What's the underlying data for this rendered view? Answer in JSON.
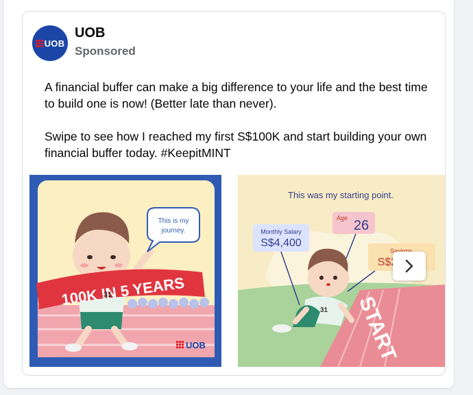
{
  "post": {
    "page_name": "UOB",
    "sponsored_label": "Sponsored",
    "avatar_text": "UOB",
    "paragraphs": [
      "A financial buffer can make a big difference to your life and the best time to build one is now! (Better late than never).",
      "Swipe to see how I reached my first S$100K and start building your own financial buffer today. #KeepitMINT"
    ]
  },
  "carousel": {
    "slides": [
      {
        "bubble_line1": "This is my",
        "bubble_line2": "journey.",
        "banner_text": "100K IN 5 YEARS",
        "bib_number": "31",
        "logo_text": "UOB"
      },
      {
        "heading": "This was my starting point.",
        "salary_label": "Monthly Salary",
        "salary_value": "S$4,400",
        "age_label": "Age",
        "age_value": "26",
        "savings_label": "Savings",
        "savings_value": "S$20,000",
        "start_text": "START",
        "bib_number": "31"
      }
    ],
    "next_icon": "chevron-right-icon"
  },
  "colors": {
    "brand_blue": "#1b46a8",
    "brand_red": "#e31b23",
    "text_primary": "#050505",
    "text_secondary": "#65676b"
  }
}
